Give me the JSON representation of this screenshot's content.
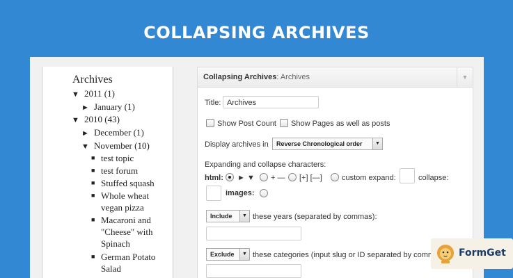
{
  "banner": {
    "title": "COLLAPSING ARCHIVES"
  },
  "archives": {
    "heading": "Archives",
    "tree": [
      {
        "type": "year",
        "arrow": "▼",
        "label": "2011 (1)"
      },
      {
        "type": "month",
        "arrow": "►",
        "label": "January (1)"
      },
      {
        "type": "year",
        "arrow": "▼",
        "label": "2010 (43)"
      },
      {
        "type": "month",
        "arrow": "►",
        "label": "December (1)"
      },
      {
        "type": "month",
        "arrow": "▼",
        "label": "November (10)"
      },
      {
        "type": "post",
        "bullet": "■",
        "label": "test topic"
      },
      {
        "type": "post",
        "bullet": "■",
        "label": "test forum"
      },
      {
        "type": "post",
        "bullet": "■",
        "label": "Stuffed squash"
      },
      {
        "type": "post",
        "bullet": "■",
        "label": "Whole wheat vegan pizza"
      },
      {
        "type": "post",
        "bullet": "■",
        "label": "Macaroni and \"Cheese\" with Spinach"
      },
      {
        "type": "post",
        "bullet": "■",
        "label": "German Potato Salad"
      }
    ]
  },
  "widget": {
    "name": "Collapsing Archives",
    "name_suffix": ": Archives",
    "toggle_icon": "▼",
    "title_label": "Title:",
    "title_value": "Archives",
    "show_post_count": "Show Post Count",
    "show_pages": "Show Pages as well as posts",
    "display_label": "Display archives in",
    "display_value": "Reverse Chronological order",
    "chars_label": "Expanding and collapse characters:",
    "html_label": "html:",
    "opt_triangles": "► ▼",
    "opt_plusminus": "+ —",
    "opt_brackets": "[+] [—]",
    "opt_custom": "custom expand:",
    "collapse_label": "collapse:",
    "images_label": "images:",
    "include_value": "Include",
    "years_label": "these years (separated by commas):",
    "exclude_value": "Exclude",
    "categories_label": "these categories (input slug or ID separated by comm",
    "dropdown_icon": "▼"
  },
  "badge": {
    "text": "FormGet"
  }
}
